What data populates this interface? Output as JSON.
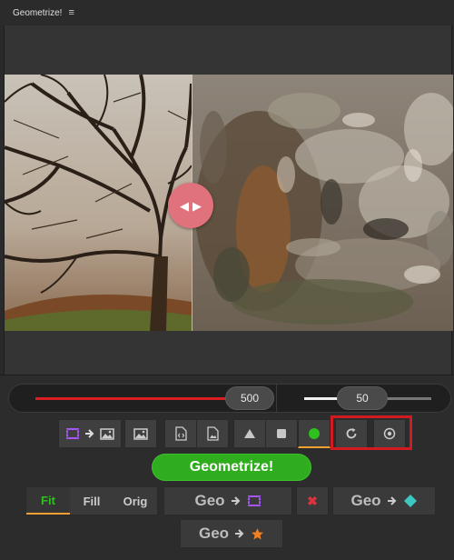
{
  "window": {
    "title": "Geometrize!",
    "menu_glyph": "≡"
  },
  "sliders": {
    "shape_count": "500",
    "alpha": "50"
  },
  "toolbar": {
    "items": [
      {
        "name": "video-to-image-button",
        "icons": [
          "film-icon",
          "arrow-right-icon",
          "image-icon"
        ]
      },
      {
        "name": "open-image-button",
        "icons": [
          "image-icon"
        ]
      },
      {
        "name": "export-svg-button",
        "icons": [
          "code-file-icon"
        ]
      },
      {
        "name": "export-image-button",
        "icons": [
          "image-file-icon"
        ]
      },
      {
        "name": "triangle-shape-button",
        "icons": [
          "triangle-icon"
        ]
      },
      {
        "name": "rectangle-shape-button",
        "icons": [
          "square-icon"
        ]
      },
      {
        "name": "circle-shape-button",
        "icons": [
          "circle-icon"
        ],
        "active": true
      },
      {
        "name": "reset-button",
        "icons": [
          "refresh-icon"
        ]
      },
      {
        "name": "settings-button",
        "icons": [
          "target-icon"
        ]
      }
    ]
  },
  "primary": {
    "geometrize_label": "Geometrize!"
  },
  "fit_modes": {
    "fit": "Fit",
    "fill": "Fill",
    "orig": "Orig",
    "active": "Fit"
  },
  "geo_buttons": {
    "geo_label": "Geo",
    "to_video": "Geo",
    "to_shape": "Geo",
    "to_star": "Geo",
    "close_glyph": "✖"
  },
  "colors": {
    "accent": "#2fad1f",
    "danger": "#d91e24",
    "highlight_box": "#d11a22",
    "handle": "#e0727c",
    "active_underline": "#f0a030",
    "icon_purple": "#a855f7",
    "icon_teal": "#3cc8c0",
    "icon_orange": "#f08020"
  }
}
